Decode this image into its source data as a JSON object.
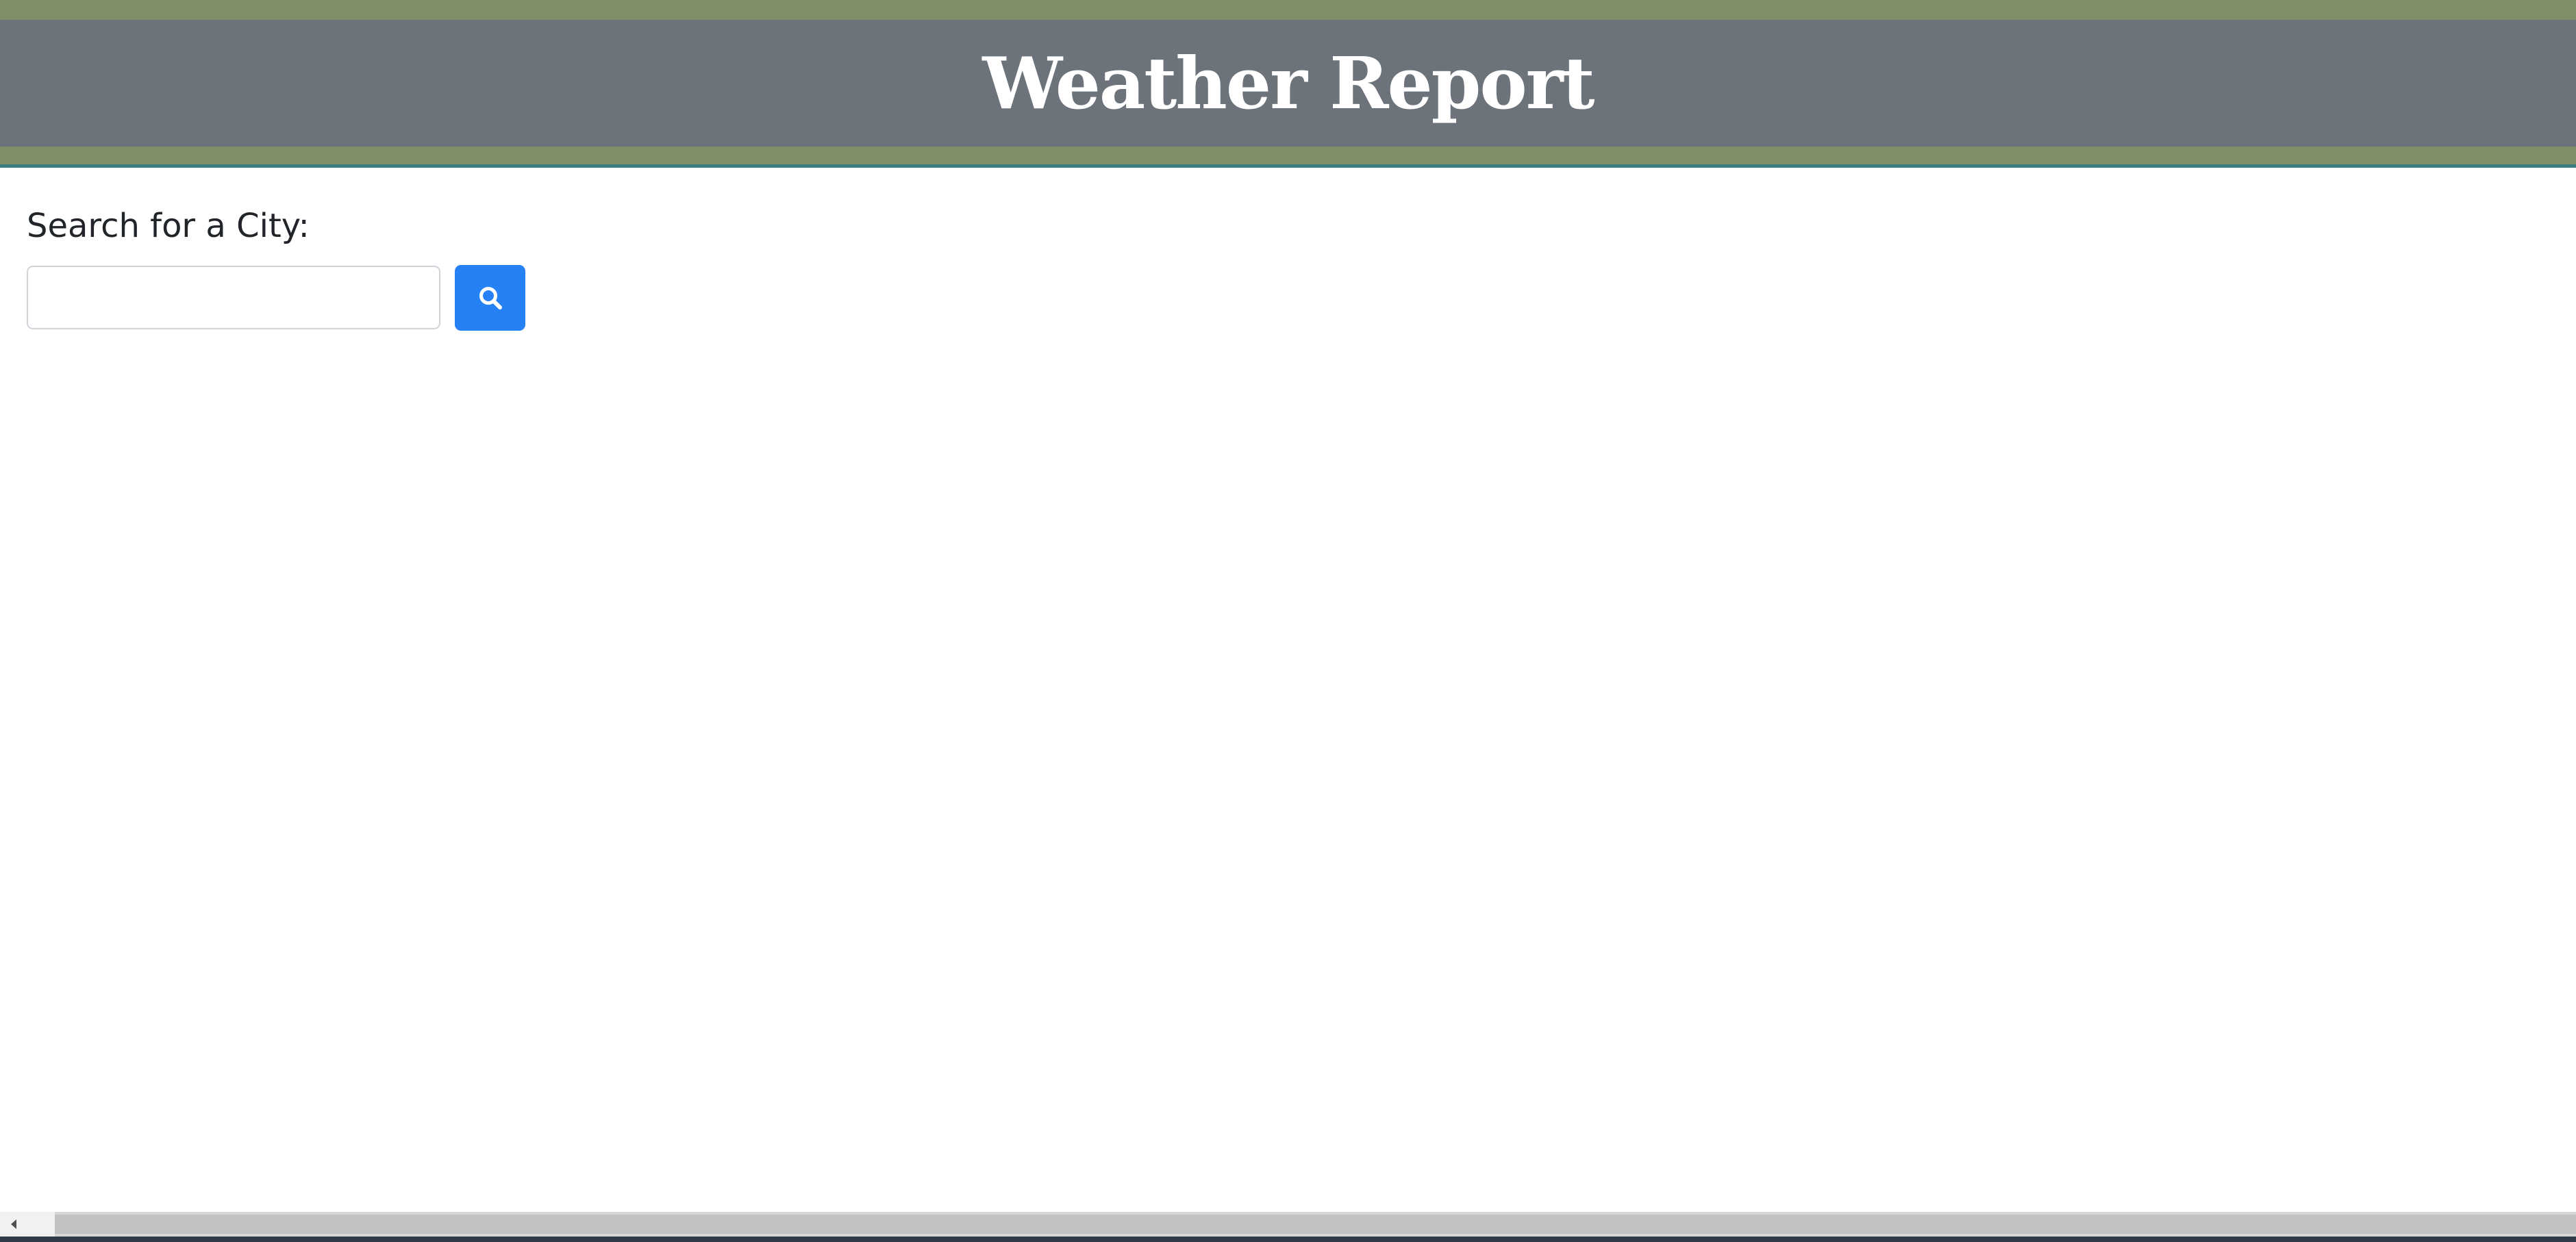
{
  "header": {
    "title": "Weather Report"
  },
  "search": {
    "label": "Search for a City:",
    "value": "",
    "placeholder": "",
    "button_icon": "search-icon"
  },
  "colors": {
    "header_outer": "#7e8e66",
    "header_inner": "#6c737b",
    "header_line": "#3b7c80",
    "button": "#2681f4",
    "text": "#212529"
  }
}
